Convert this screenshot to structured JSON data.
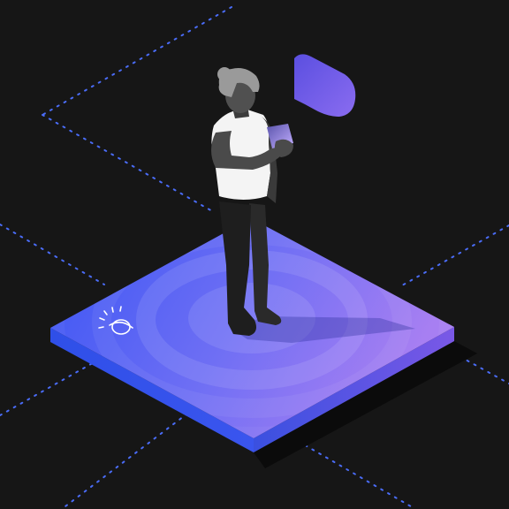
{
  "colors": {
    "background": "#161616",
    "grid_dots": "#4a6cf7",
    "platform_blue": "#3f5ff5",
    "platform_violet": "#9a7cf2",
    "platform_edge_dark": "#2a3bb8",
    "platform_edge_violet": "#6a4fd0",
    "figure_dark": "#1f1f1f",
    "figure_mid": "#4a4a4a",
    "figure_hair": "#9a9a9a",
    "shirt": "#f4f4f4",
    "speech_bubble": "#7b63e6",
    "device_glow": "#b49cff"
  },
  "icons": {
    "platform_logo": "globe-orbit-icon",
    "speech": "speech-bubble-icon",
    "device": "handheld-device-icon"
  }
}
